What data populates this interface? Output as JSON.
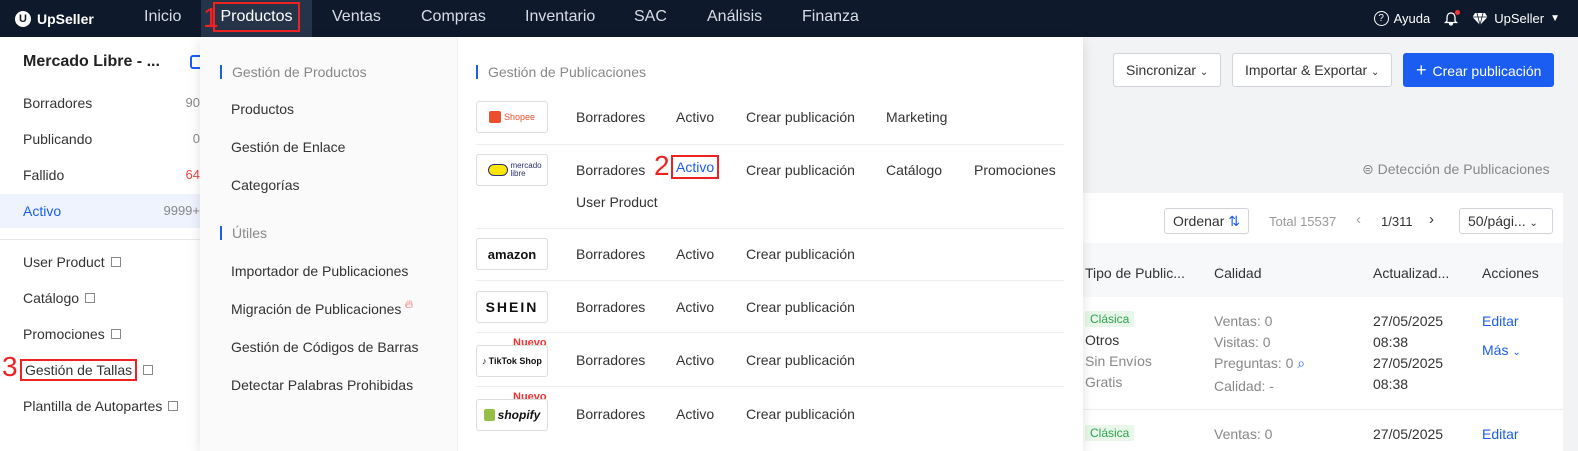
{
  "topnav": {
    "logo": "UpSeller",
    "items": [
      "Inicio",
      "Productos",
      "Ventas",
      "Compras",
      "Inventario",
      "SAC",
      "Análisis",
      "Finanza"
    ],
    "help": "Ayuda",
    "user": "UpSeller"
  },
  "annotations": {
    "step1": "1",
    "step2": "2",
    "step3": "3"
  },
  "sidebar": {
    "store": "Mercado Libre - ...",
    "items": [
      {
        "label": "Borradores",
        "count": "90"
      },
      {
        "label": "Publicando",
        "count": "0"
      },
      {
        "label": "Fallido",
        "count": "64"
      },
      {
        "label": "Activo",
        "count": "9999+"
      }
    ],
    "links": [
      "User Product",
      "Catálogo",
      "Promociones",
      "Gestión de Tallas",
      "Plantilla de Autopartes"
    ]
  },
  "dropdown": {
    "left_heading1": "Gestión de Productos",
    "left_links1": [
      "Productos",
      "Gestión de Enlace",
      "Categorías"
    ],
    "left_heading2": "Útiles",
    "left_links2": [
      "Importador de Publicaciones",
      "Migración de Publicaciones",
      "Gestión de Códigos de Barras",
      "Detectar Palabras Prohibidas"
    ],
    "right_heading": "Gestión de Publicaciones",
    "nuevo": "Nuevo",
    "channels": [
      {
        "logo": "Shopee",
        "links": [
          "Borradores",
          "Activo",
          "Crear publicación",
          "Marketing"
        ]
      },
      {
        "logo": "mercado libre",
        "links": [
          "Borradores",
          "Activo",
          "Crear publicación",
          "Catálogo",
          "Promociones",
          "User Product"
        ]
      },
      {
        "logo": "amazon",
        "links": [
          "Borradores",
          "Activo",
          "Crear publicación"
        ]
      },
      {
        "logo": "SHEIN",
        "links": [
          "Borradores",
          "Activo",
          "Crear publicación"
        ]
      },
      {
        "logo": "TikTok Shop",
        "links": [
          "Borradores",
          "Activo",
          "Crear publicación"
        ]
      },
      {
        "logo": "shopify",
        "links": [
          "Borradores",
          "Activo",
          "Crear publicación"
        ]
      }
    ]
  },
  "content": {
    "btn_sync": "Sincronizar",
    "btn_import": "Importar & Exportar",
    "btn_create": "Crear publicación",
    "detect": "Detección de Publicaciones",
    "order": "Ordenar",
    "total": "Total 15537",
    "page": "1/311",
    "per_page": "50/pági...",
    "headers": [
      "Tipo de Public...",
      "Calidad",
      "Actualizad...",
      "Acciones"
    ],
    "row1": {
      "tag": "Clásica",
      "type1": "Otros",
      "type2": "Sin Envíos",
      "type3": "Gratis",
      "ventas": "Ventas: 0",
      "visitas": "Visitas: 0",
      "preguntas": "Preguntas: 0",
      "calidad": "Calidad: -",
      "date1": "27/05/2025",
      "time1": "08:38",
      "date2": "27/05/2025",
      "time2": "08:38",
      "edit": "Editar",
      "more": "Más"
    },
    "row2": {
      "tag": "Clásica",
      "ventas": "Ventas: 0",
      "date1": "27/05/2025",
      "edit": "Editar"
    }
  }
}
